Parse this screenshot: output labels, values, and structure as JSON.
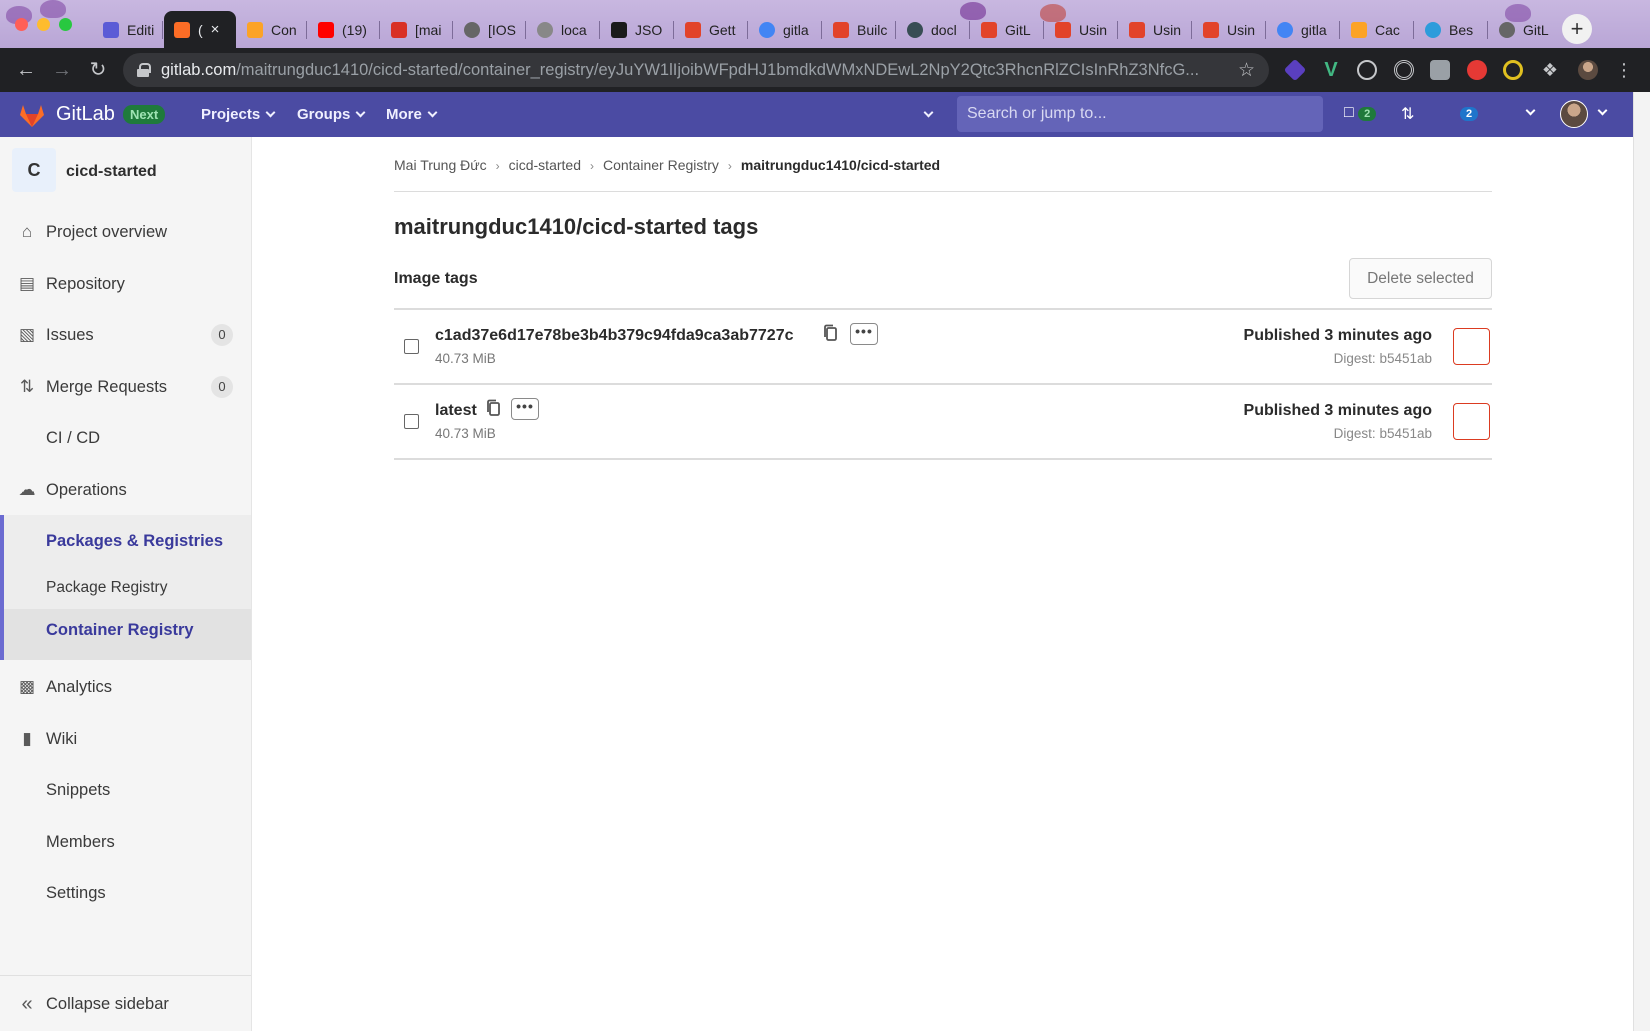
{
  "browser": {
    "tabs": [
      {
        "label": "Editi",
        "fav": "#5b5bd6"
      },
      {
        "label": "(",
        "fav": "#fc6d26",
        "active": true
      },
      {
        "label": "Con",
        "fav": "#fca326"
      },
      {
        "label": "(19)",
        "fav": "#ff0000"
      },
      {
        "label": "[mai",
        "fav": "#d93025"
      },
      {
        "label": "[IOS",
        "fav": "#666666"
      },
      {
        "label": "loca",
        "fav": "#888888"
      },
      {
        "label": "JSO",
        "fav": "#1a1a1a"
      },
      {
        "label": "Gett",
        "fav": "#e2432a"
      },
      {
        "label": "gitla",
        "fav": "#4285f4"
      },
      {
        "label": "Builc",
        "fav": "#e2432a"
      },
      {
        "label": "docl",
        "fav": "#384d54"
      },
      {
        "label": "GitL",
        "fav": "#e2432a"
      },
      {
        "label": "Usin",
        "fav": "#e2432a"
      },
      {
        "label": "Usin",
        "fav": "#e2432a"
      },
      {
        "label": "Usin",
        "fav": "#e2432a"
      },
      {
        "label": "gitla",
        "fav": "#4285f4"
      },
      {
        "label": "Cac",
        "fav": "#fca326"
      },
      {
        "label": "Bes",
        "fav": "#2d9cdb"
      },
      {
        "label": "GitL",
        "fav": "#666666"
      }
    ],
    "close_glyph": "×",
    "new_tab_glyph": "+",
    "url_host": "gitlab.com",
    "url_path": "/maitrungduc1410/cicd-started/container_registry/eyJuYW1lIjoibWFpdHJ1bmdkdWMxNDEwL2NpY2Qtc3RhcnRlZCIsInRhZ3NfcG..."
  },
  "header": {
    "brand": "GitLab",
    "badge": "Next",
    "nav": [
      "Projects",
      "Groups",
      "More"
    ],
    "search_placeholder": "Search or jump to...",
    "issues_count": "2",
    "todos_count": "2",
    "colors": {
      "bar": "#4b4ba3",
      "search": "#6464b8"
    }
  },
  "sidebar": {
    "project_initial": "C",
    "project_name": "cicd-started",
    "items": [
      {
        "label": "Project overview",
        "icon": "home-icon"
      },
      {
        "label": "Repository",
        "icon": "document-icon"
      },
      {
        "label": "Issues",
        "icon": "issues-icon",
        "count": "0"
      },
      {
        "label": "Merge Requests",
        "icon": "merge-request-icon",
        "count": "0"
      },
      {
        "label": "CI / CD",
        "icon": "rocket-icon"
      },
      {
        "label": "Operations",
        "icon": "cloud-gear-icon"
      },
      {
        "label": "Packages & Registries",
        "icon": "package-icon"
      },
      {
        "label": "Package Registry"
      },
      {
        "label": "Container Registry"
      },
      {
        "label": "Analytics",
        "icon": "chart-icon"
      },
      {
        "label": "Wiki",
        "icon": "book-icon"
      },
      {
        "label": "Snippets",
        "icon": "snippet-icon"
      },
      {
        "label": "Members",
        "icon": "users-icon"
      },
      {
        "label": "Settings",
        "icon": "gear-icon"
      }
    ],
    "collapse_label": "Collapse sidebar"
  },
  "main": {
    "breadcrumbs": [
      "Mai Trung Đức",
      "cicd-started",
      "Container Registry",
      "maitrungduc1410/cicd-started"
    ],
    "title": "maitrungduc1410/cicd-started tags",
    "section": "Image tags",
    "delete_selected": "Delete selected",
    "more_glyph": "•••",
    "tags": [
      {
        "name": "c1ad37e6d17e78be3b4b379c94fda9ca3ab7727c",
        "size": "40.73 MiB",
        "published": "Published 3 minutes ago",
        "digest": "Digest: b5451ab"
      },
      {
        "name": "latest",
        "size": "40.73 MiB",
        "published": "Published 3 minutes ago",
        "digest": "Digest: b5451ab"
      }
    ],
    "colors": {
      "danger": "#db3b21",
      "active_nav": "#3a3a9c"
    }
  }
}
